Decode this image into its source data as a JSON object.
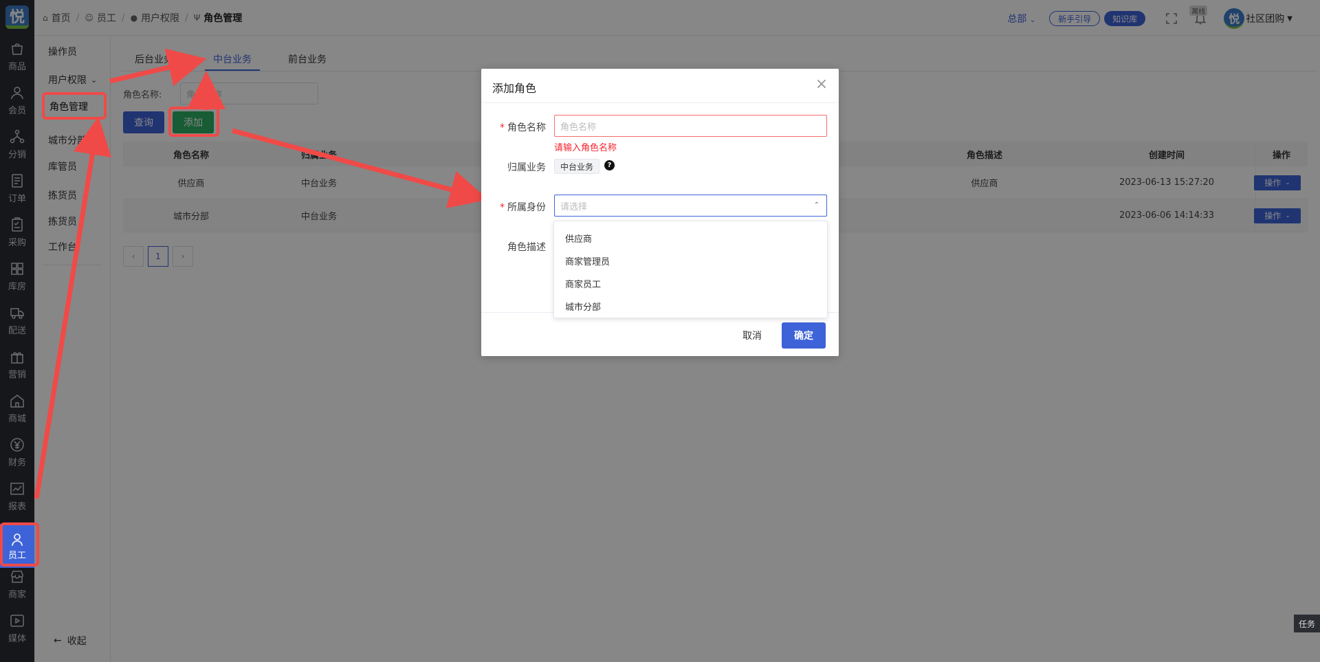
{
  "rail": {
    "items": [
      {
        "label": "商品",
        "icon": "bag-icon"
      },
      {
        "label": "会员",
        "icon": "user-icon"
      },
      {
        "label": "分销",
        "icon": "share-icon"
      },
      {
        "label": "订单",
        "icon": "order-icon"
      },
      {
        "label": "采购",
        "icon": "clipboard-icon"
      },
      {
        "label": "库房",
        "icon": "warehouse-icon"
      },
      {
        "label": "配送",
        "icon": "truck-icon"
      },
      {
        "label": "营销",
        "icon": "gift-icon"
      },
      {
        "label": "商城",
        "icon": "home-icon"
      },
      {
        "label": "财务",
        "icon": "yen-icon"
      },
      {
        "label": "报表",
        "icon": "chart-icon"
      },
      {
        "label": "员工",
        "icon": "staff-icon"
      },
      {
        "label": "商家",
        "icon": "shop-icon"
      },
      {
        "label": "媒体",
        "icon": "play-icon"
      }
    ],
    "active_index": 11
  },
  "submenu": {
    "items": [
      "操作员",
      "用户权限",
      "角色管理",
      "城市分部",
      "库管员",
      "拣货员",
      "拣货员",
      "工作台"
    ],
    "collapse_label": "收起"
  },
  "header": {
    "breadcrumbs": [
      "首页",
      "员工",
      "用户权限",
      "角色管理"
    ],
    "hq_label": "总部",
    "guide_label": "新手引导",
    "kb_label": "知识库",
    "offline_label": "离线",
    "user_name": "社区团购",
    "logo_char": "悦"
  },
  "tabs": [
    "后台业务",
    "中台业务",
    "前台业务"
  ],
  "filter": {
    "label": "角色名称:",
    "placeholder": "角色名称"
  },
  "buttons": {
    "query": "查询",
    "add": "添加"
  },
  "table": {
    "headers": [
      "角色名称",
      "归属业务",
      "角色描述",
      "创建时间",
      "操作"
    ],
    "rows": [
      {
        "name": "供应商",
        "biz": "中台业务",
        "desc": "供应商",
        "time": "2023-06-13 15:27:20",
        "op": "操作"
      },
      {
        "name": "城市分部",
        "biz": "中台业务",
        "desc": "",
        "time": "2023-06-06 14:14:33",
        "op": "操作"
      }
    ]
  },
  "pager": {
    "prev": "‹",
    "current": "1",
    "next": "›"
  },
  "dialog": {
    "title": "添加角色",
    "name_label": "角色名称",
    "name_placeholder": "角色名称",
    "name_error": "请输入角色名称",
    "biz_label": "归属业务",
    "biz_tag": "中台业务",
    "identity_label": "所属身份",
    "identity_placeholder": "请选择",
    "desc_label": "角色描述",
    "cancel": "取消",
    "ok": "确定"
  },
  "dropdown": {
    "options": [
      "供应商",
      "商家管理员",
      "商家员工",
      "城市分部"
    ]
  },
  "task_badge": "任务",
  "colors": {
    "primary": "#3e63d8",
    "success": "#2cae63",
    "error": "#f5222d",
    "annotation": "#f04a48"
  }
}
